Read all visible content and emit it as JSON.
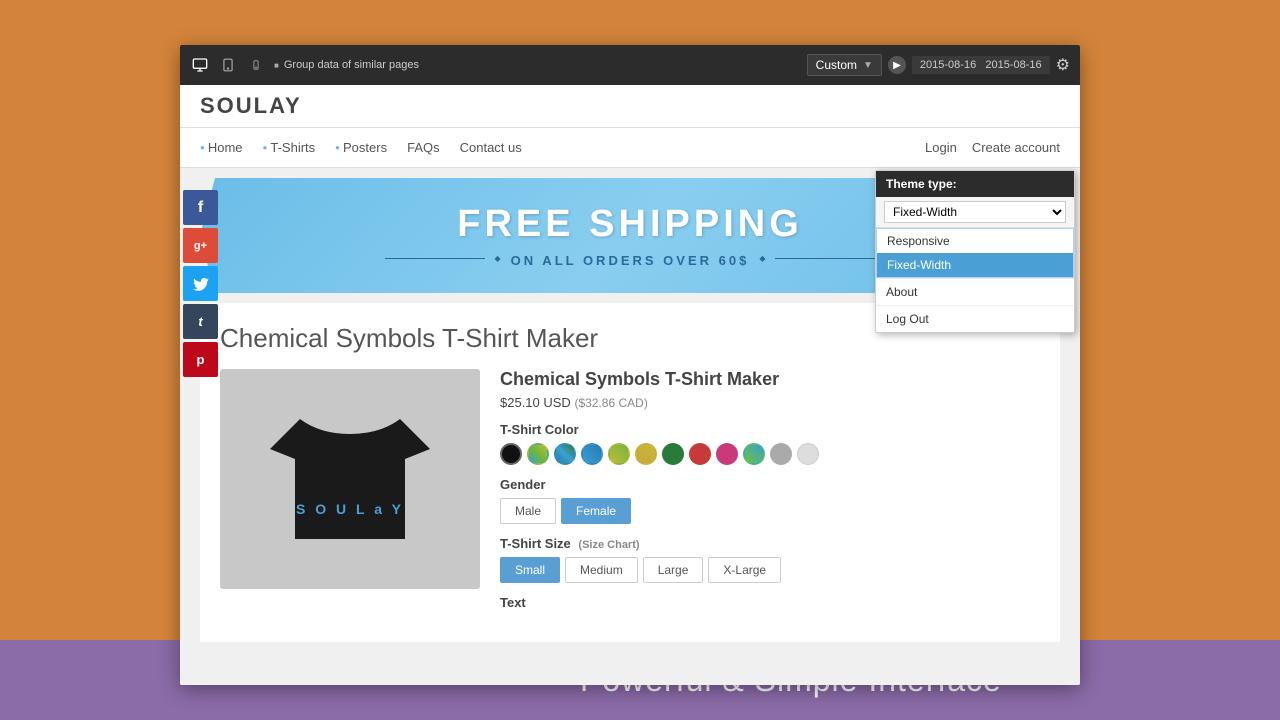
{
  "background": {
    "color": "#d4843a"
  },
  "bottom_bar": {
    "text": "Powerful & Simple Interface",
    "color": "#8b6ba8"
  },
  "browser": {
    "toolbar": {
      "page_label": "Group data of similar pages",
      "custom_dropdown_label": "Custom",
      "date_start": "2015-08-16",
      "date_end": "2015-08-16"
    }
  },
  "website": {
    "logo": "SOULAY",
    "nav": {
      "links": [
        "Home",
        "T-Shirts",
        "Posters",
        "FAQs",
        "Contact us"
      ],
      "auth_links": [
        "Login",
        "Create account"
      ]
    },
    "banner": {
      "title": "FREE SHIPPING",
      "subtitle": "ON ALL ORDERS OVER 60$"
    },
    "product": {
      "page_title": "Chemical Symbols T-Shirt Maker",
      "name": "Chemical Symbols T-Shirt Maker",
      "price_usd": "$25.10 USD",
      "price_cad": "($32.86 CAD)",
      "color_label": "T-Shirt Color",
      "colors": [
        {
          "name": "black",
          "hex": "#111111",
          "selected": true
        },
        {
          "name": "multicolor1",
          "hex": "#6db83a"
        },
        {
          "name": "multicolor2",
          "hex": "#3a9fd4"
        },
        {
          "name": "multicolor3",
          "hex": "#2a7ab5"
        },
        {
          "name": "multicolor4",
          "hex": "#c8b83a"
        },
        {
          "name": "multicolor5",
          "hex": "#c8a83a"
        },
        {
          "name": "dark-green",
          "hex": "#2a7a3a"
        },
        {
          "name": "red",
          "hex": "#c83a3a"
        },
        {
          "name": "pink",
          "hex": "#c83a7a"
        },
        {
          "name": "light-green",
          "hex": "#6ac43a"
        },
        {
          "name": "gray",
          "hex": "#aaaaaa"
        },
        {
          "name": "light-gray",
          "hex": "#dddddd"
        }
      ],
      "gender_label": "Gender",
      "genders": [
        {
          "label": "Male",
          "active": true
        },
        {
          "label": "Female",
          "active": true
        }
      ],
      "size_label": "T-Shirt Size",
      "size_chart_label": "(Size Chart)",
      "sizes": [
        {
          "label": "Small",
          "active": true
        },
        {
          "label": "Medium",
          "active": false
        },
        {
          "label": "Large",
          "active": false
        },
        {
          "label": "X-Large",
          "active": false
        }
      ],
      "text_label": "Text"
    }
  },
  "theme_dropdown": {
    "header": "Theme type:",
    "current": "Fixed-Width",
    "options": [
      "Responsive",
      "Fixed-Width"
    ],
    "selected_option": "Fixed-Width",
    "menu_items": [
      "About",
      "Log Out"
    ]
  },
  "social": {
    "buttons": [
      {
        "label": "f",
        "class": "social-fb",
        "name": "facebook"
      },
      {
        "label": "g+",
        "class": "social-gp",
        "name": "google-plus"
      },
      {
        "label": "t",
        "class": "social-tw",
        "name": "twitter"
      },
      {
        "label": "t",
        "class": "social-tm",
        "name": "tumblr"
      },
      {
        "label": "p",
        "class": "social-pt",
        "name": "pinterest"
      }
    ]
  }
}
